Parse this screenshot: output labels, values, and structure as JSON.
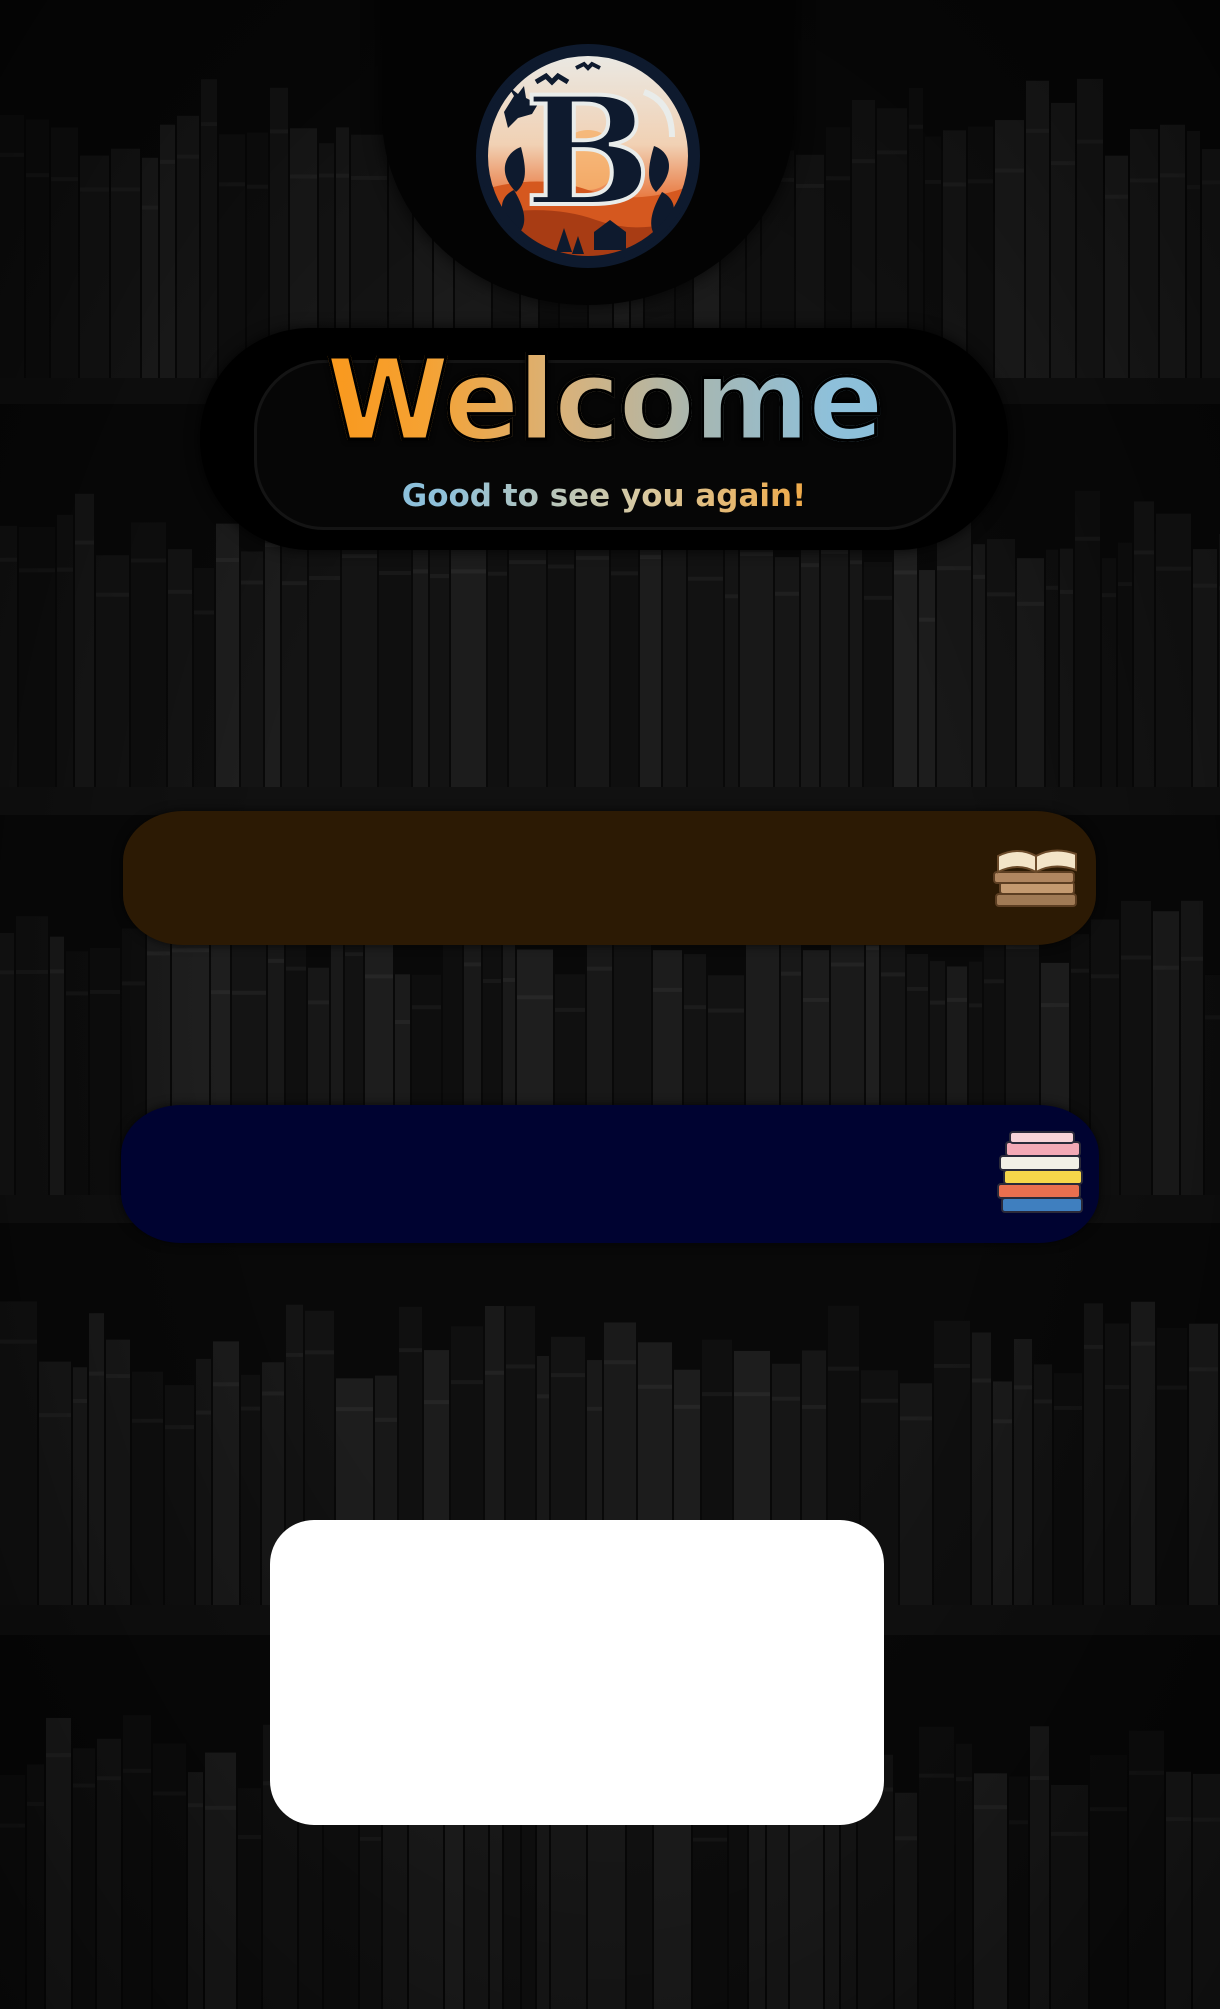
{
  "welcome": {
    "title": "Welcome",
    "subtitle": "Good to see you again!"
  },
  "logo": {
    "icon": "b-monogram-logo-icon",
    "letter": "B"
  },
  "fields": [
    {
      "name": "brown-field",
      "icon": "open-books-stack-icon",
      "color": "#2c1a04"
    },
    {
      "name": "navy-field",
      "icon": "colorful-books-stack-icon",
      "color": "#000331"
    }
  ],
  "colors": {
    "accent_orange": "#ff8c00",
    "accent_blue": "#86bddb",
    "panel_white": "#ffffff"
  }
}
